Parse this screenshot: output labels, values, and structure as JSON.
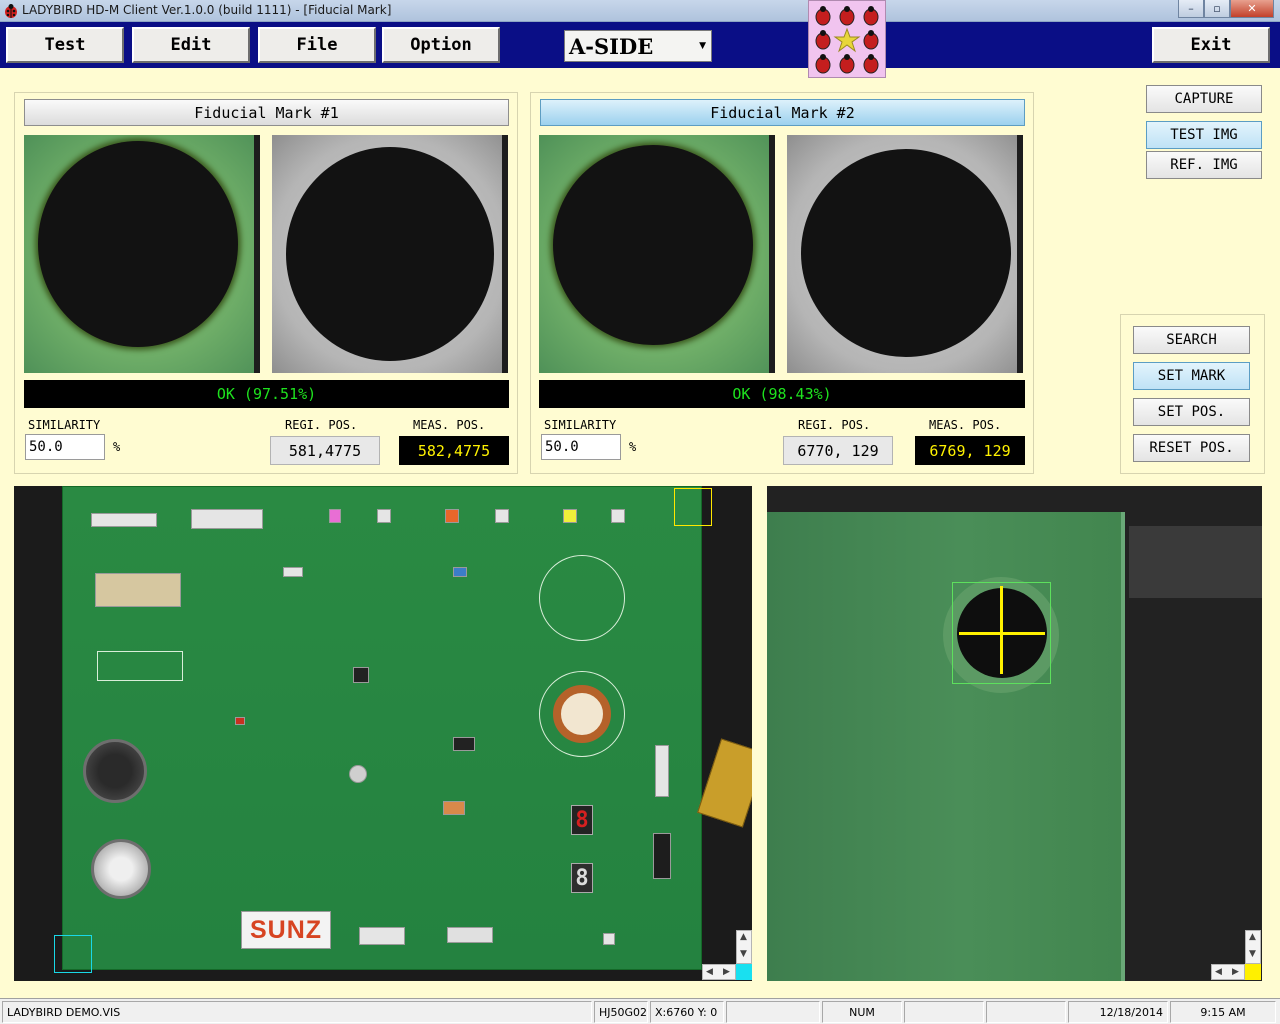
{
  "window": {
    "title": "LADYBIRD HD-M Client Ver.1.0.0  (build 1111) - [Fiducial Mark]",
    "minimize": "–",
    "maximize": "▫",
    "close": "✕"
  },
  "menu": {
    "test": "Test",
    "edit": "Edit",
    "file": "File",
    "option": "Option",
    "side_select": "A-SIDE",
    "exit": "Exit"
  },
  "fiducial": [
    {
      "header": "Fiducial Mark #1",
      "result": "OK (97.51%)",
      "similarity_label": "SIMILARITY",
      "similarity_value": "50.0",
      "percent": "%",
      "regi_label": "REGI. POS.",
      "regi_value": "581,4775",
      "meas_label": "MEAS. POS.",
      "meas_value": "582,4775"
    },
    {
      "header": "Fiducial Mark  #2",
      "result": "OK (98.43%)",
      "similarity_label": "SIMILARITY",
      "similarity_value": "50.0",
      "percent": "%",
      "regi_label": "REGI. POS.",
      "regi_value": "6770, 129",
      "meas_label": "MEAS. POS.",
      "meas_value": "6769, 129"
    }
  ],
  "image_buttons": {
    "capture": "CAPTURE",
    "test_img": "TEST IMG",
    "ref_img": "REF. IMG"
  },
  "mark_buttons": {
    "search": "SEARCH",
    "set_mark": "SET MARK",
    "set_pos": "SET POS.",
    "reset_pos": "RESET POS."
  },
  "board": {
    "brand": "SUNZ",
    "segment": "8"
  },
  "status": {
    "file": "LADYBIRD DEMO.VIS",
    "model": "HJ50G02",
    "coords": "X:6760 Y:  0",
    "num": "NUM",
    "date": "12/18/2014",
    "time": "9:15 AM"
  },
  "colors": {
    "menu_band": "#0A0E86",
    "background": "#FFFCD2",
    "ok_text": "#1EE21E",
    "meas_text": "#FFF200",
    "crosshair": "#FFF000"
  }
}
